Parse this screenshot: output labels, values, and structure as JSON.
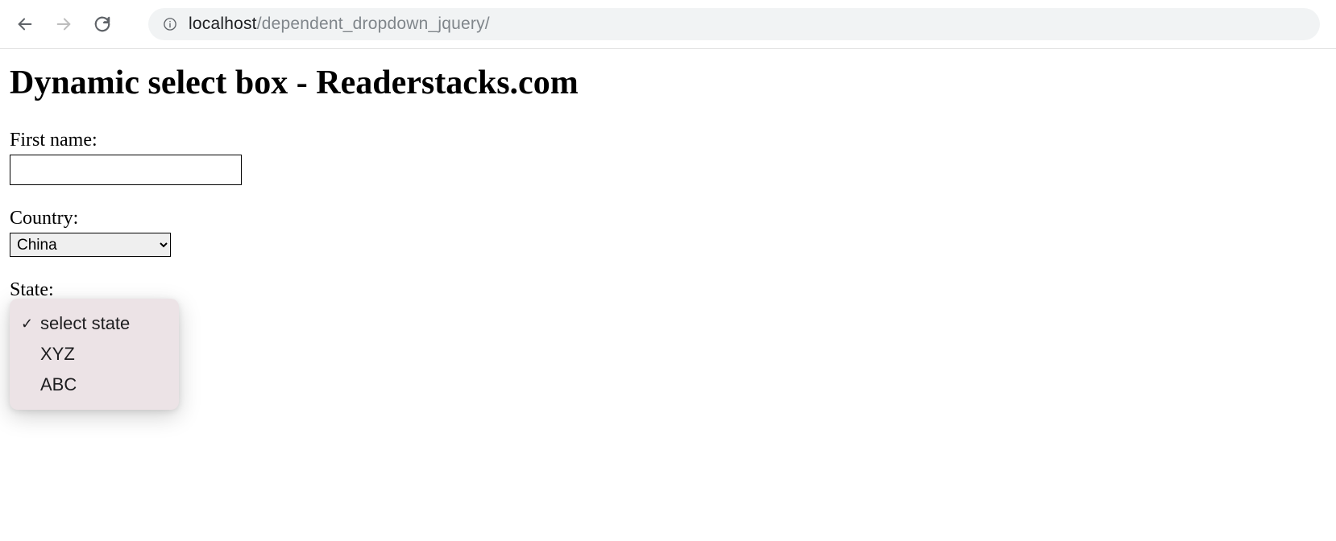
{
  "browser": {
    "url_host": "localhost",
    "url_path": "/dependent_dropdown_jquery/"
  },
  "page": {
    "heading": "Dynamic select box - Readerstacks.com"
  },
  "form": {
    "first_name": {
      "label": "First name:",
      "value": ""
    },
    "country": {
      "label": "Country:",
      "selected": "China"
    },
    "state": {
      "label": "State:",
      "options": [
        {
          "label": "select state",
          "selected": true
        },
        {
          "label": "XYZ",
          "selected": false
        },
        {
          "label": "ABC",
          "selected": false
        }
      ]
    }
  }
}
